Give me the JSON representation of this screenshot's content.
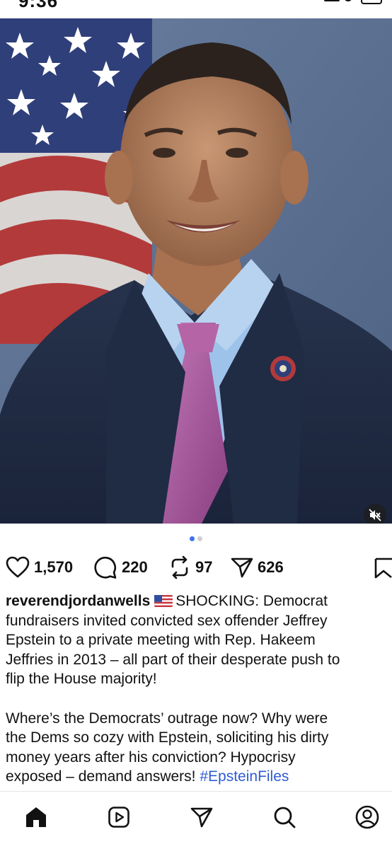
{
  "status_bar": {
    "time": "9:36"
  },
  "post": {
    "media": {
      "subject_description": "portrait",
      "carousel": {
        "pages": 2,
        "active": 1
      }
    },
    "actions": {
      "likes": "1,570",
      "comments": "220",
      "reposts": "97",
      "shares": "626"
    },
    "caption": {
      "username": "reverendjordanwells",
      "flag_emoji": "🇺🇸",
      "text_lines": [
        "SHOCKING: Democrat",
        "fundraisers invited convicted sex offender Jeffrey",
        "Epstein to a private meeting with Rep. Hakeem",
        "Jeffries in 2013 – all part of their desperate push to",
        "flip the House majority!"
      ],
      "text_lines_2": [
        "Where’s the Democrats’ outrage now? Why were",
        "the Dems so cozy with Epstein, soliciting his dirty",
        "money years after his conviction? Hypocrisy",
        "exposed – demand answers! "
      ],
      "hashtag": "#EpsteinFiles"
    }
  },
  "colors": {
    "accent_blue": "#3b73f0",
    "hashtag_blue": "#2f5bd6",
    "text": "#111111"
  },
  "icons": {
    "like": "heart-icon",
    "comment": "comment-bubble-icon",
    "repost": "repost-icon",
    "share": "send-icon",
    "save": "bookmark-icon",
    "mute": "speaker-muted-icon",
    "tabs": [
      "home-icon",
      "reels-icon",
      "send-icon",
      "search-icon",
      "profile-icon"
    ]
  }
}
